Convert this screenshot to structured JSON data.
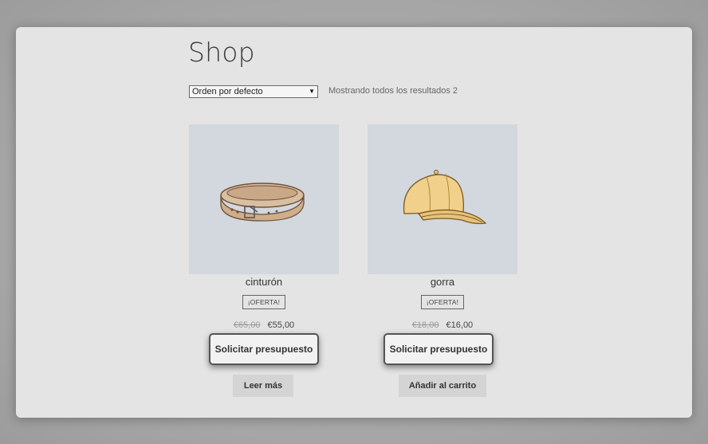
{
  "shop": {
    "title": "Shop",
    "sort": {
      "selected": "Orden por defecto"
    },
    "result_count": "Mostrando todos los resultados 2"
  },
  "products": [
    {
      "name": "cinturón",
      "badge": "¡OFERTA!",
      "old_price": "€65,00",
      "new_price": "€55,00",
      "quote_label": "Solicitar presupuesto",
      "action_label": "Leer más",
      "image": "belt-image"
    },
    {
      "name": "gorra",
      "badge": "¡OFERTA!",
      "old_price": "€18,00",
      "new_price": "€16,00",
      "quote_label": "Solicitar presupuesto",
      "action_label": "Añadir al carrito",
      "image": "cap-image"
    }
  ],
  "colors": {
    "page_bg": "#e4e4e4",
    "thumb_bg": "#d3d7de",
    "button_bg": "#d4d4d4"
  }
}
